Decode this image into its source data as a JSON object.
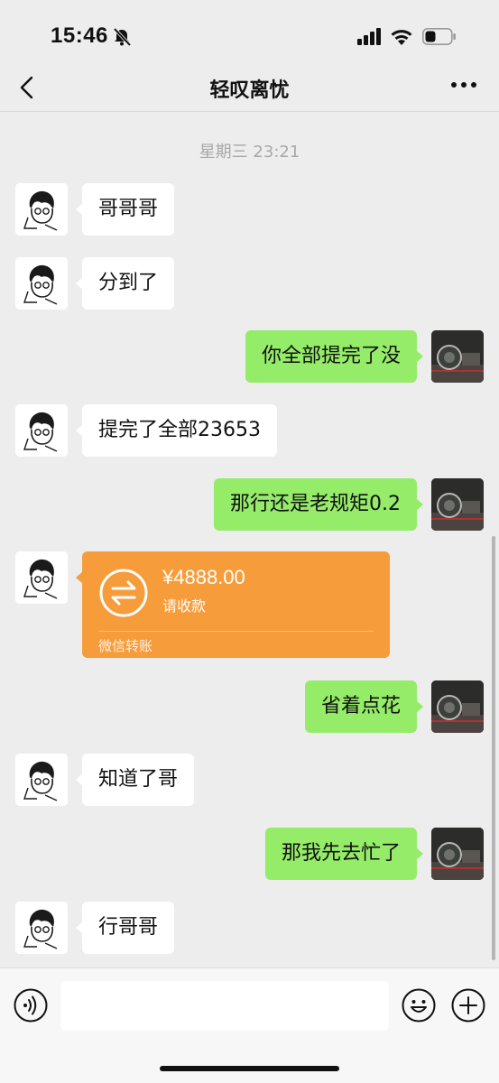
{
  "status_bar": {
    "time": "15:46"
  },
  "nav": {
    "title": "轻叹离忧"
  },
  "chat": {
    "timestamp": "星期三 23:21",
    "messages": [
      {
        "side": "left",
        "text": "哥哥哥"
      },
      {
        "side": "left",
        "text": "分到了"
      },
      {
        "side": "right",
        "text": "你全部提完了没"
      },
      {
        "side": "left",
        "text": "提完了全部23653"
      },
      {
        "side": "right",
        "text": "那行还是老规矩0.2"
      },
      {
        "side": "right",
        "text": "省着点花"
      },
      {
        "side": "left",
        "text": "知道了哥"
      },
      {
        "side": "right",
        "text": "那我先去忙了"
      },
      {
        "side": "left",
        "text": "行哥哥"
      }
    ],
    "transfer": {
      "amount": "¥4888.00",
      "note": "请收款",
      "footer": "微信转账"
    }
  },
  "colors": {
    "background": "#ededed",
    "bubble_self": "#95ec69",
    "bubble_other": "#ffffff",
    "transfer_card": "#f79c3a",
    "timestamp": "#a8a8a8"
  },
  "icons": [
    "bell-off-icon",
    "signal-icon",
    "wifi-icon",
    "battery-icon",
    "back-arrow-icon",
    "more-icon",
    "transfer-arrows-icon",
    "voice-icon",
    "emoji-icon",
    "plus-icon"
  ]
}
